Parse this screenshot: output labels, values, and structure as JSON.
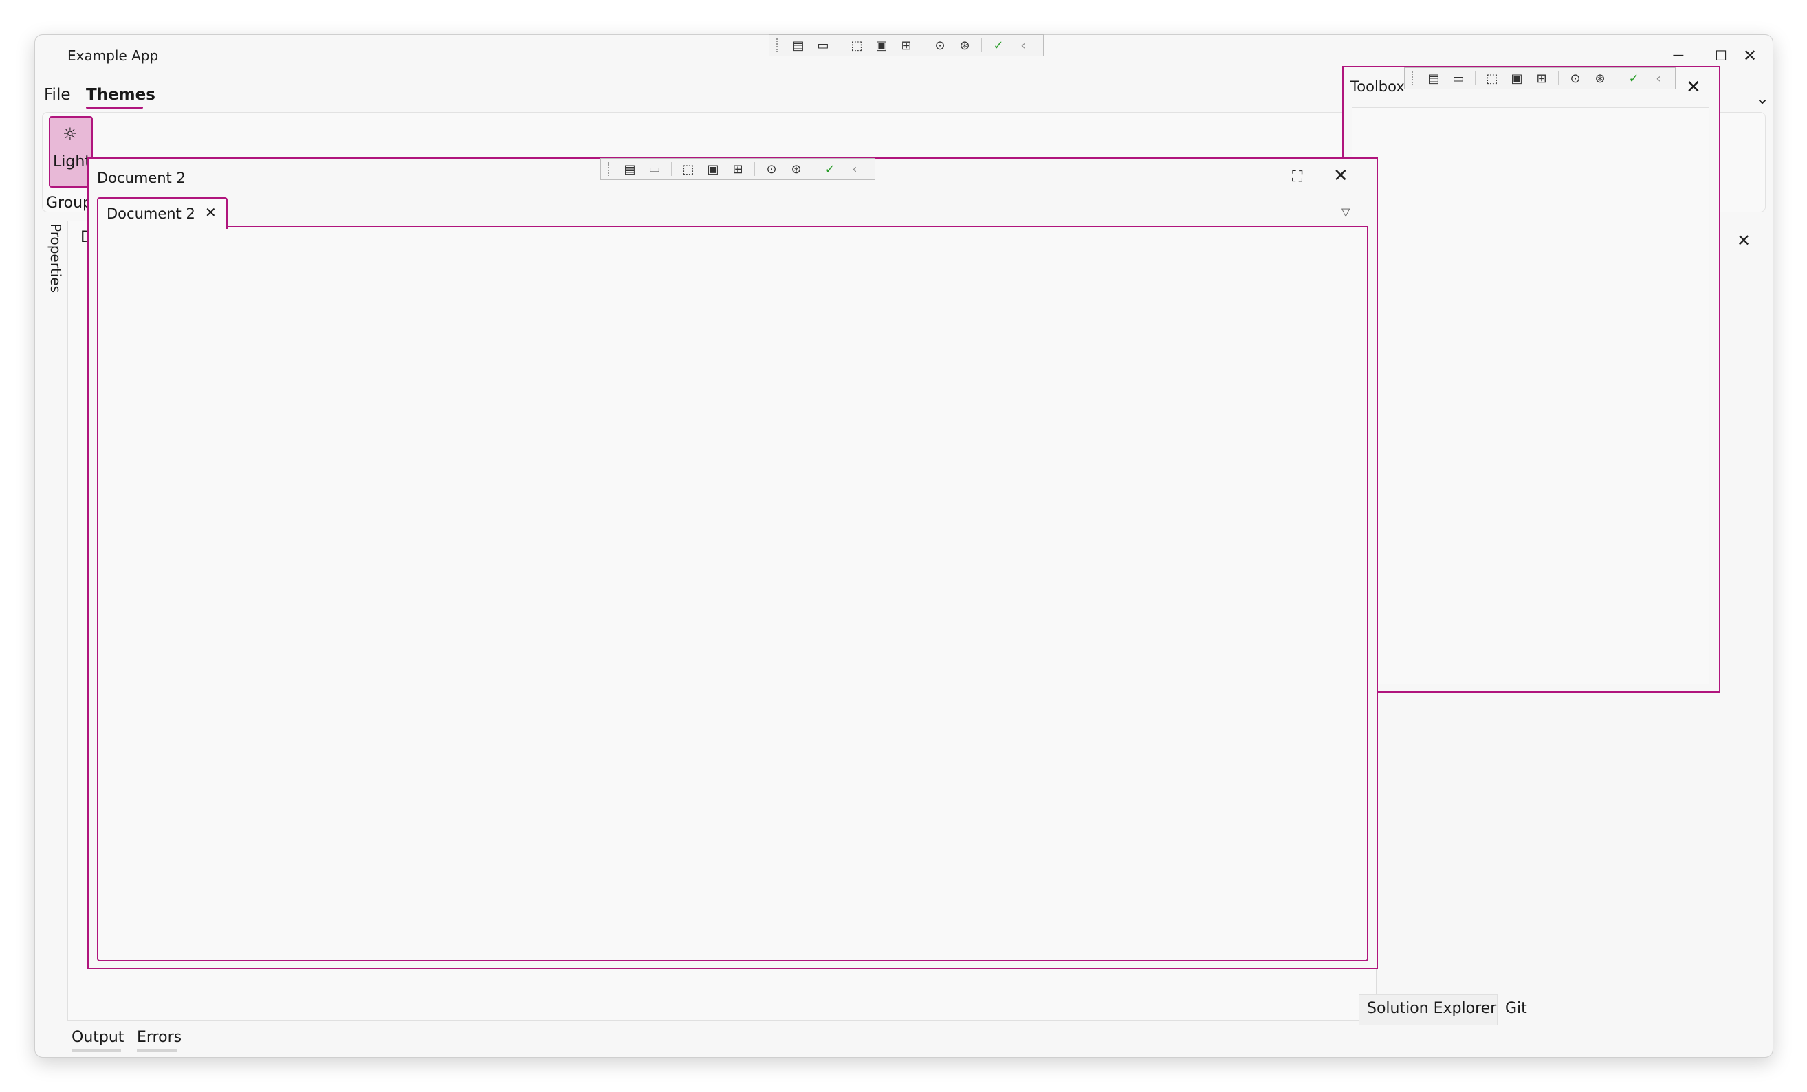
{
  "app": {
    "title": "Example App"
  },
  "window_controls": {
    "minimize": "─",
    "maximize": "☐",
    "close": "✕"
  },
  "menu": {
    "items": [
      {
        "label": "File"
      },
      {
        "label": "Themes",
        "active": true
      }
    ],
    "overflow_icon": "⌄"
  },
  "ribbon": {
    "light_button": {
      "icon": "☼",
      "label": "Light"
    },
    "group_label": "Group"
  },
  "side_panel": {
    "tab_label": "Properties",
    "background_doc_label": "D"
  },
  "document_window": {
    "title": "Document 2",
    "tab_label": "Document 2",
    "tab_close": "✕",
    "maximize_icon": "⛶",
    "close_icon": "✕",
    "dropdown_icon": "▽"
  },
  "toolbox_window": {
    "title": "Toolbox",
    "close_icon": "✕"
  },
  "right_dock": {
    "close_icon": "✕",
    "tabs": [
      {
        "label": "Solution Explorer",
        "active": true
      },
      {
        "label": "Git"
      }
    ]
  },
  "bottom_tabs": [
    {
      "label": "Output"
    },
    {
      "label": "Errors"
    }
  ],
  "debug_toolbar": {
    "icons": [
      "live-visual-tree-icon",
      "record-icon",
      "select-element-icon",
      "display-layout-adorners-icon",
      "track-focus-icon",
      "binding-failures-icon",
      "accessibility-icon",
      "hot-reload-check-icon",
      "collapse-icon"
    ]
  },
  "colors": {
    "accent": "#b0157d",
    "accent_light": "#e8b9d7",
    "background": "#f7f7f7",
    "check_green": "#2a9d2a"
  }
}
